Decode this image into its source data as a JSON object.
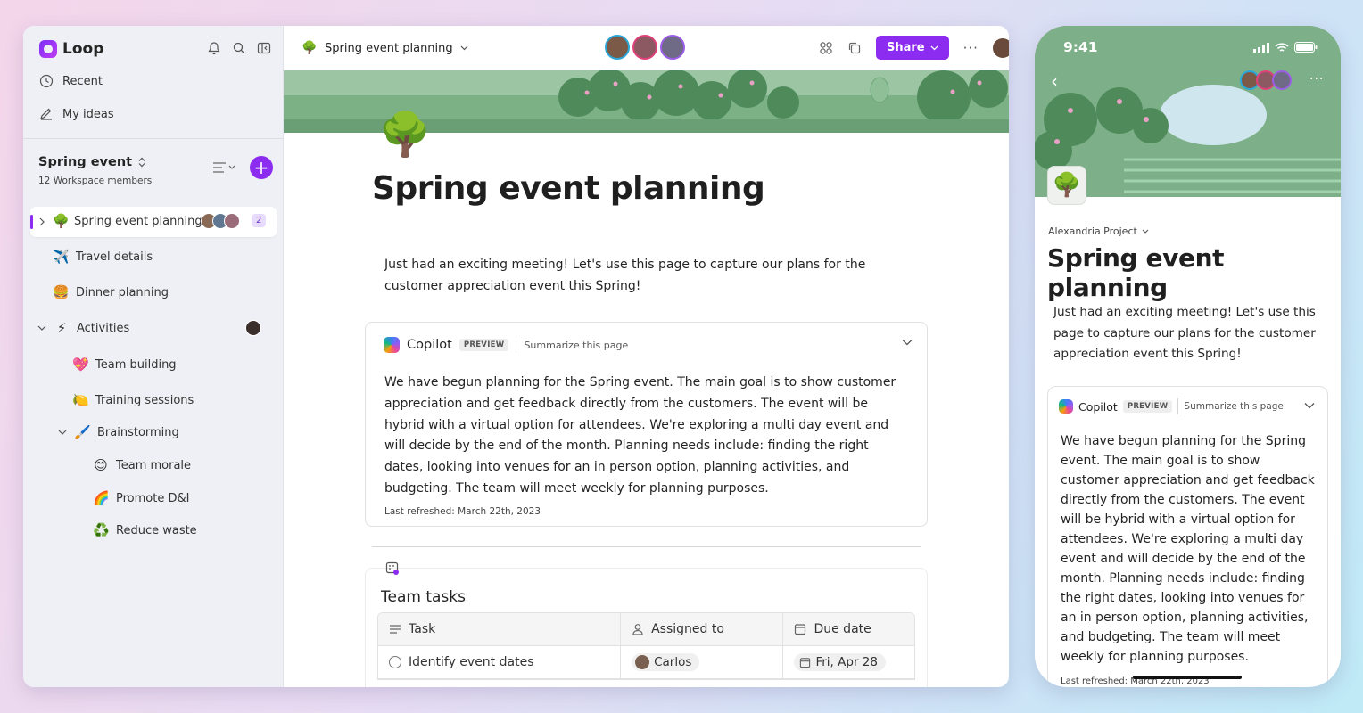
{
  "desktop": {
    "app_name": "Loop",
    "nav": [
      {
        "icon": "clock-icon",
        "label": "Recent"
      },
      {
        "icon": "pen-icon",
        "label": "My ideas"
      }
    ],
    "workspace": {
      "title": "Spring event",
      "members": "12 Workspace members"
    },
    "tree": [
      {
        "emoji": "🌳",
        "label": "Spring event planning",
        "badge": "2"
      },
      {
        "emoji": "✈️",
        "label": "Travel details"
      },
      {
        "emoji": "🍔",
        "label": "Dinner planning"
      },
      {
        "emoji": "⚡",
        "label": "Activities"
      },
      {
        "emoji": "💖",
        "label": "Team building"
      },
      {
        "emoji": "🍋",
        "label": "Training sessions"
      },
      {
        "emoji": "🖌️",
        "label": "Brainstorming"
      },
      {
        "emoji": "😊",
        "label": "Team morale"
      },
      {
        "emoji": "🌈",
        "label": "Promote D&I"
      },
      {
        "emoji": "♻️",
        "label": "Reduce waste"
      }
    ],
    "breadcrumb": "Spring event planning",
    "share_label": "Share",
    "page": {
      "emoji": "🌳",
      "title": "Spring event planning",
      "intro": "Just had an exciting meeting! Let's use this page to capture our plans for the customer appreciation event this Spring!"
    },
    "copilot": {
      "name": "Copilot",
      "badge": "PREVIEW",
      "action": "Summarize this page",
      "body": "We have begun planning for the Spring event. The main goal is to show customer appreciation and get feedback directly from the customers. The event will be hybrid with a virtual option for attendees. We're exploring a multi day event and will decide by the end of the month. Planning needs include: finding the right dates, looking into venues for an in person option, planning activities, and budgeting. The team will meet weekly for planning purposes.",
      "footer": "Last refreshed: March 22th, 2023"
    },
    "tasks": {
      "title": "Team tasks",
      "columns": [
        "Task",
        "Assigned to",
        "Due date"
      ],
      "rows": [
        {
          "task": "Identify event dates",
          "assignee": "Carlos",
          "due": "Fri, Apr 28"
        }
      ]
    }
  },
  "phone": {
    "time": "9:41",
    "crumb": "Alexandria Project",
    "title": "Spring event planning",
    "intro": "Just had an exciting meeting! Let's use this page to capture our plans for the customer appreciation event this Spring!",
    "copilot": {
      "name": "Copilot",
      "badge": "PREVIEW",
      "action": "Summarize this page",
      "body": "We have begun planning for the Spring event. The main goal is to show customer appreciation and get feedback directly from the customers. The event will be hybrid with a virtual option for attendees. We're exploring a multi day event and will decide by the end of the month. Planning needs include: finding the right dates, looking into venues for an in person option, planning activities, and budgeting. The team will meet weekly for planning purposes.",
      "footer": "Last refreshed: March 22th, 2023"
    }
  },
  "colors": {
    "accent": "#8b2cf0",
    "sidebar_bg": "#eef0f5",
    "banner_green": "#6fa77a"
  }
}
